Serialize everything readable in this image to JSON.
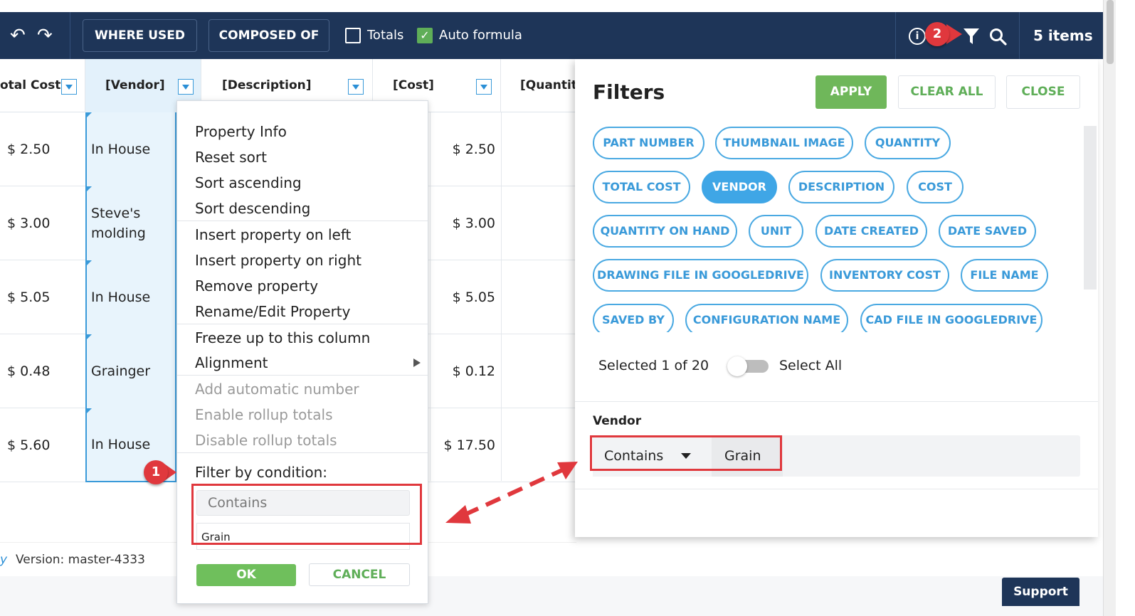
{
  "toolbar": {
    "undo_icon": "undo-icon",
    "redo_icon": "redo-icon",
    "where_used": "WHERE USED",
    "composed_of": "COMPOSED OF",
    "totals_label": "Totals",
    "totals_checked": false,
    "auto_formula_label": "Auto formula",
    "auto_formula_checked": true,
    "items_count": "5 items"
  },
  "grid": {
    "headers": {
      "total_cost": "otal Cost",
      "vendor": "[Vendor]",
      "description": "[Description]",
      "cost": "[Cost]",
      "quantity": "[Quantity"
    },
    "rows": [
      {
        "total_cost": "$ 2.50",
        "vendor": "In House",
        "cost": "$ 2.50"
      },
      {
        "total_cost": "$ 3.00",
        "vendor": "Steve's molding",
        "cost": "$ 3.00"
      },
      {
        "total_cost": "$ 5.05",
        "vendor": "In House",
        "cost": "$ 5.05"
      },
      {
        "total_cost": "$ 0.48",
        "vendor": "Grainger",
        "cost": "$ 0.12"
      },
      {
        "total_cost": "$ 5.60",
        "vendor": "In House",
        "cost": "$ 17.50"
      }
    ]
  },
  "status": {
    "prefix": "y",
    "version": "Version: master-4333"
  },
  "context_menu": {
    "items": [
      {
        "label": "Property Info",
        "disabled": false
      },
      {
        "label": "Reset sort",
        "disabled": false
      },
      {
        "label": "Sort ascending",
        "disabled": false
      },
      {
        "label": "Sort descending",
        "disabled": false
      },
      {
        "label": "Insert property on left",
        "disabled": false
      },
      {
        "label": "Insert property on right",
        "disabled": false
      },
      {
        "label": "Remove property",
        "disabled": false
      },
      {
        "label": "Rename/Edit Property",
        "disabled": false
      },
      {
        "label": "Freeze up to this column",
        "disabled": false
      },
      {
        "label": "Alignment",
        "disabled": false
      },
      {
        "label": "Add automatic number",
        "disabled": true
      },
      {
        "label": "Enable rollup totals",
        "disabled": true
      },
      {
        "label": "Disable rollup totals",
        "disabled": true
      }
    ],
    "filter_label": "Filter by condition:",
    "condition": "Contains",
    "value": "Grain",
    "ok": "OK",
    "cancel": "CANCEL"
  },
  "filters": {
    "title": "Filters",
    "apply": "APPLY",
    "clear_all": "CLEAR ALL",
    "close": "CLOSE",
    "chips": [
      {
        "label": "PART NUMBER",
        "selected": false
      },
      {
        "label": "THUMBNAIL IMAGE",
        "selected": false
      },
      {
        "label": "QUANTITY",
        "selected": false
      },
      {
        "label": "TOTAL COST",
        "selected": false
      },
      {
        "label": "VENDOR",
        "selected": true
      },
      {
        "label": "DESCRIPTION",
        "selected": false
      },
      {
        "label": "COST",
        "selected": false
      },
      {
        "label": "QUANTITY ON HAND",
        "selected": false
      },
      {
        "label": "UNIT",
        "selected": false
      },
      {
        "label": "DATE CREATED",
        "selected": false
      },
      {
        "label": "DATE SAVED",
        "selected": false
      },
      {
        "label": "DRAWING FILE IN GOOGLEDRIVE",
        "selected": false
      },
      {
        "label": "INVENTORY COST",
        "selected": false
      },
      {
        "label": "FILE NAME",
        "selected": false
      },
      {
        "label": "SAVED BY",
        "selected": false
      },
      {
        "label": "CONFIGURATION NAME",
        "selected": false
      },
      {
        "label": "CAD FILE IN GOOGLEDRIVE",
        "selected": false
      }
    ],
    "selected_count": "Selected 1 of 20",
    "select_all_label": "Select All",
    "select_all_on": false,
    "vendor_label": "Vendor",
    "condition": "Contains",
    "value": "Grain"
  },
  "annotations": {
    "marker_1": "1",
    "marker_2": "2"
  },
  "support": "Support",
  "colors": {
    "toolbar_bg": "#1e3558",
    "accent_blue": "#3fa6e6",
    "apply_green": "#6fb75a",
    "annotation_red": "#e0383d"
  }
}
